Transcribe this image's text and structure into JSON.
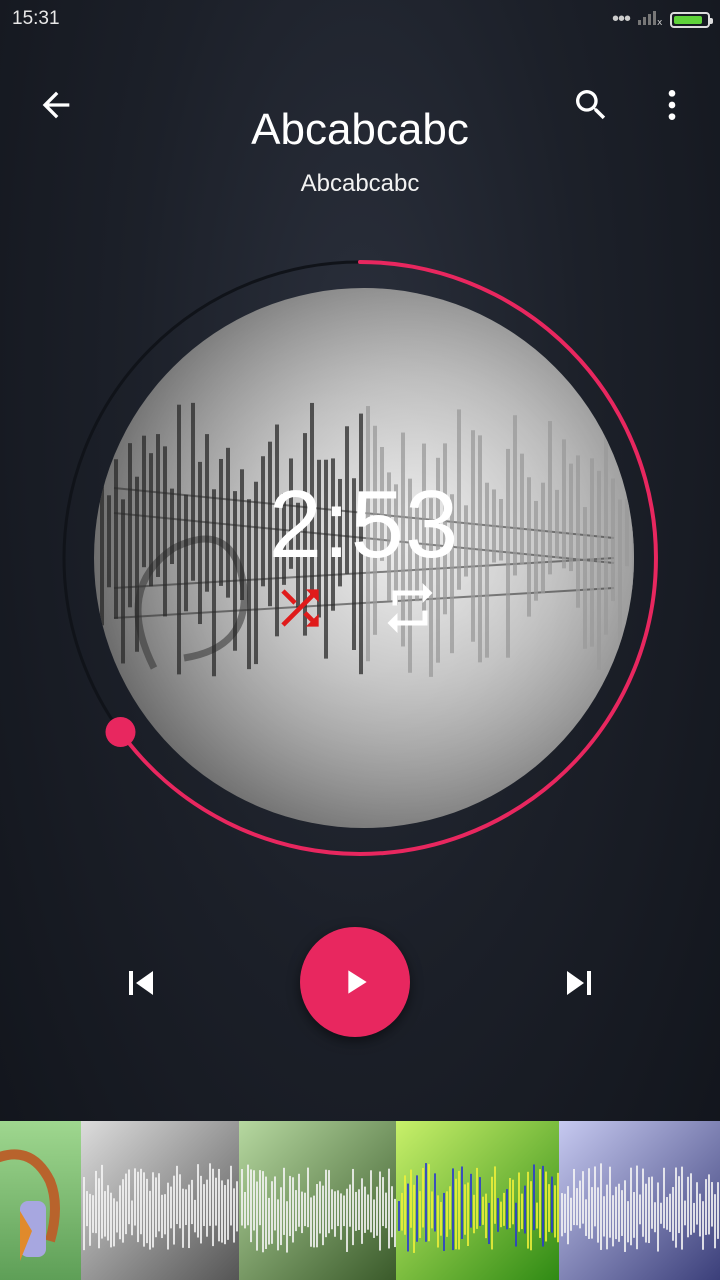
{
  "status": {
    "time": "15:31"
  },
  "toolbar": {
    "title": "Abcabcabc",
    "subtitle": "Abcabcabc"
  },
  "player": {
    "time_display": "2:53",
    "progress": 0.65
  },
  "colors": {
    "accent": "#e8275f",
    "shuffle_active": "#e01b1b"
  },
  "icons": {
    "back": "arrow-left-icon",
    "search": "search-icon",
    "more": "more-vert-icon",
    "shuffle": "shuffle-icon",
    "repeat": "repeat-icon",
    "previous": "skip-previous-icon",
    "play": "play-icon",
    "next": "skip-next-icon"
  },
  "themes": [
    {
      "name": "headphones",
      "colors": [
        "#9fd78f",
        "#5e9f57"
      ]
    },
    {
      "name": "gray",
      "colors": [
        "#dcdcdc",
        "#555555"
      ]
    },
    {
      "name": "green",
      "colors": [
        "#b6d8a0",
        "#3a5a2a"
      ]
    },
    {
      "name": "lime",
      "colors": [
        "#c8f06a",
        "#2f8a14"
      ]
    },
    {
      "name": "lavender",
      "colors": [
        "#c6c9f0",
        "#3b3f7a"
      ]
    }
  ]
}
